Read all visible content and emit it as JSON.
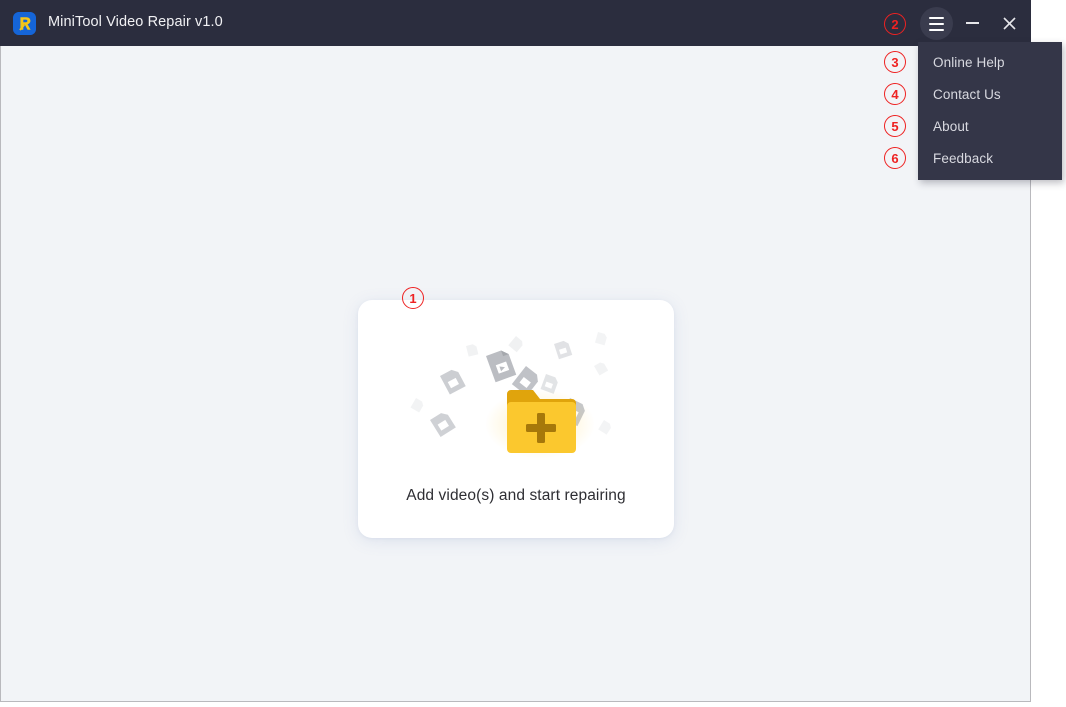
{
  "window": {
    "title": "MiniTool Video Repair v1.0",
    "logo_icon": "minitool-r-logo",
    "controls": {
      "menu_icon": "hamburger-menu-icon",
      "minimize_icon": "minimize-icon",
      "close_icon": "close-icon"
    }
  },
  "menu": {
    "open": true,
    "items": [
      {
        "label": "Online Help"
      },
      {
        "label": "Contact Us"
      },
      {
        "label": "About"
      },
      {
        "label": "Feedback"
      }
    ]
  },
  "main": {
    "drop_card": {
      "label": "Add video(s) and start repairing",
      "illustration_icon": "folder-add-video-icon"
    }
  },
  "annotations": [
    {
      "id": "1",
      "number": "1",
      "target": "drop-card"
    },
    {
      "id": "2",
      "number": "2",
      "target": "menu-button"
    },
    {
      "id": "3",
      "number": "3",
      "target": "menu-item-online-help"
    },
    {
      "id": "4",
      "number": "4",
      "target": "menu-item-contact-us"
    },
    {
      "id": "5",
      "number": "5",
      "target": "menu-item-about"
    },
    {
      "id": "6",
      "number": "6",
      "target": "menu-item-feedback"
    }
  ],
  "colors": {
    "titlebar": "#2b2d3e",
    "menu_background": "#343648",
    "content_background": "#f2f4f7",
    "card_background": "#ffffff",
    "folder_body": "#fbc82e",
    "folder_tab": "#e0a40c",
    "annotation": "#ee2222",
    "logo_background": "#1565d8"
  }
}
